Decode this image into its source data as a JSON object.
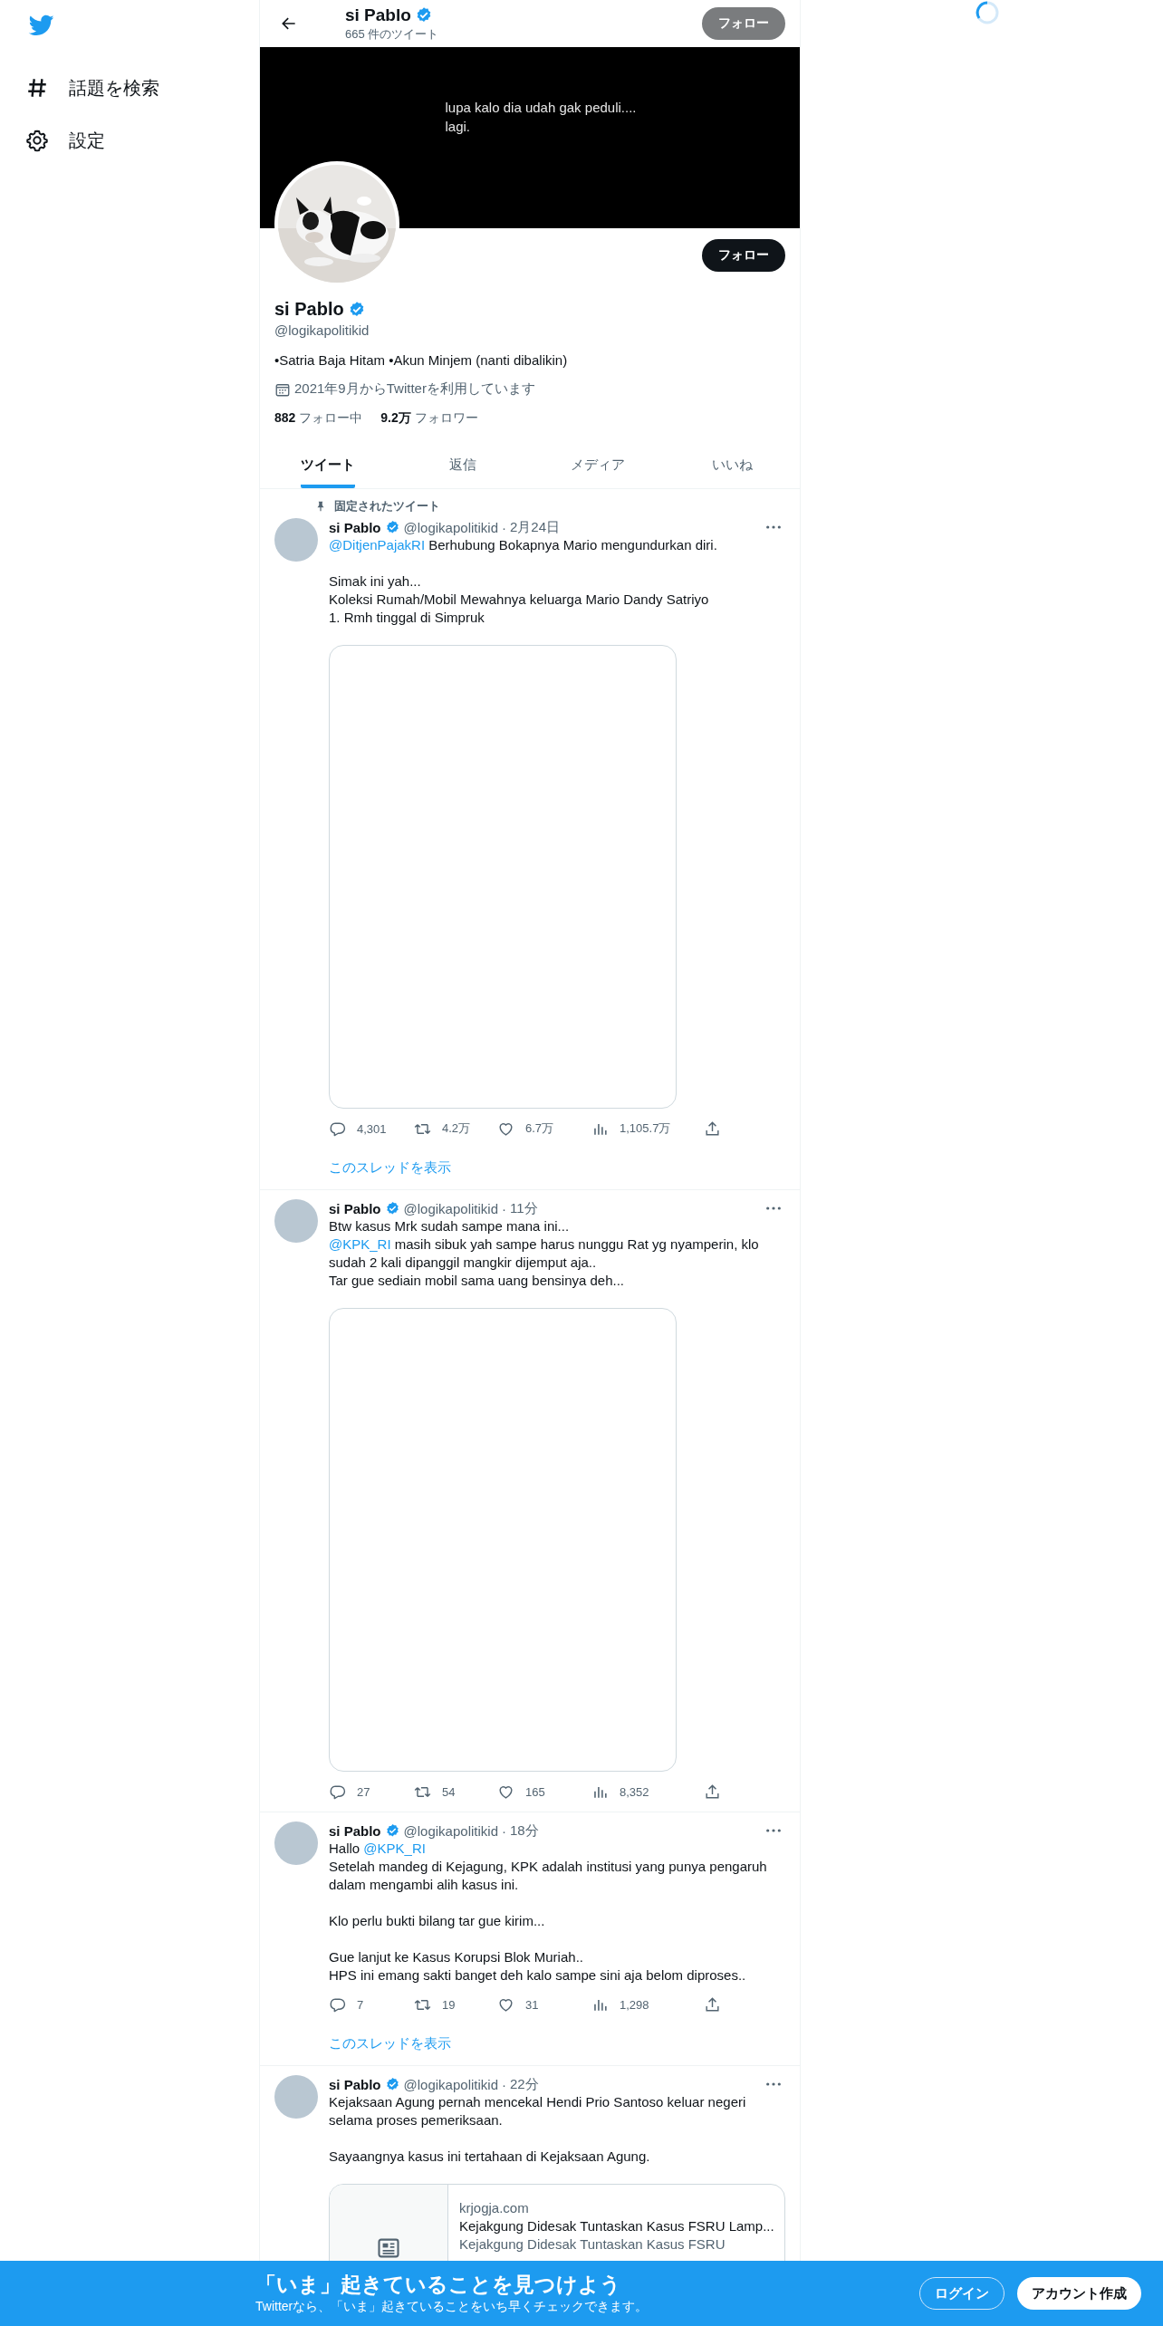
{
  "sidebar": {
    "items": [
      {
        "label": "話題を検索",
        "kind": "hashtag"
      },
      {
        "label": "設定",
        "kind": "gear"
      }
    ]
  },
  "header": {
    "title": "si Pablo",
    "subtitle": "665 件のツイート",
    "follow": "フォロー"
  },
  "banner": {
    "text": "lupa kalo dia udah gak peduli....\nlagi."
  },
  "profile": {
    "follow": "フォロー",
    "name": "si Pablo",
    "handle": "@logikapolitikid",
    "bio": "•Satria Baja Hitam •Akun Minjem (nanti dibalikin)",
    "joined": "2021年9月からTwitterを利用しています",
    "following_count": "882",
    "following_label": "フォロー中",
    "followers_count": "9.2万",
    "followers_label": "フォロワー"
  },
  "tabs": [
    {
      "label": "ツイート",
      "selected": true
    },
    {
      "label": "返信",
      "selected": false
    },
    {
      "label": "メディア",
      "selected": false
    },
    {
      "label": "いいね",
      "selected": false
    }
  ],
  "tweets": [
    {
      "pinned_label": "固定されたツイート",
      "name": "si Pablo",
      "handle": "@logikapolitikid",
      "separator": "·",
      "time": "2月24日",
      "paragraphs": [
        [
          {
            "kind": "mention",
            "text": "@DitjenPajakRI"
          },
          {
            "kind": "text",
            "text": " Berhubung Bokapnya Mario mengundurkan diri."
          }
        ],
        [
          {
            "kind": "text",
            "text": "Simak ini yah...\nKoleksi Rumah/Mobil Mewahnya keluarga Mario Dandy Satriyo\n1. Rmh tinggal di Simpruk"
          }
        ]
      ],
      "media": {
        "kind": "empty"
      },
      "stats": {
        "replies": "4,301",
        "retweets": "4.2万",
        "likes": "6.7万",
        "views": "1,105.7万"
      },
      "show_thread": "このスレッドを表示"
    },
    {
      "name": "si Pablo",
      "handle": "@logikapolitikid",
      "separator": "·",
      "time": "11分",
      "paragraphs": [
        [
          {
            "kind": "text",
            "text": "Btw kasus Mrk sudah sampe mana ini...\n"
          },
          {
            "kind": "mention",
            "text": "@KPK_RI"
          },
          {
            "kind": "text",
            "text": " masih sibuk yah sampe harus nunggu Rat yg nyamperin, klo sudah 2 kali dipanggil mangkir dijemput aja..\nTar gue sediain mobil sama uang bensinya deh..."
          }
        ]
      ],
      "media": {
        "kind": "empty"
      },
      "stats": {
        "replies": "27",
        "retweets": "54",
        "likes": "165",
        "views": "8,352"
      }
    },
    {
      "name": "si Pablo",
      "handle": "@logikapolitikid",
      "separator": "·",
      "time": "18分",
      "paragraphs": [
        [
          {
            "kind": "text",
            "text": "Hallo "
          },
          {
            "kind": "mention",
            "text": "@KPK_RI"
          },
          {
            "kind": "text",
            "text": "\nSetelah mandeg di Kejagung, KPK adalah institusi yang punya pengaruh dalam mengambi alih kasus ini."
          }
        ],
        [
          {
            "kind": "text",
            "text": "Klo perlu bukti bilang tar gue kirim..."
          }
        ],
        [
          {
            "kind": "text",
            "text": "Gue lanjut ke Kasus Korupsi Blok Muriah..\nHPS ini emang sakti banget deh kalo sampe sini aja belom diproses.."
          }
        ]
      ],
      "stats": {
        "replies": "7",
        "retweets": "19",
        "likes": "31",
        "views": "1,298"
      },
      "show_thread": "このスレッドを表示"
    },
    {
      "name": "si Pablo",
      "handle": "@logikapolitikid",
      "separator": "·",
      "time": "22分",
      "paragraphs": [
        [
          {
            "kind": "text",
            "text": "Kejaksaan Agung pernah mencekal Hendi Prio Santoso keluar negeri selama proses pemeriksaan."
          }
        ],
        [
          {
            "kind": "text",
            "text": "Sayaangnya kasus ini tertahaan di Kejaksaan Agung."
          }
        ]
      ],
      "link_card": {
        "domain": "krjogja.com",
        "title": "Kejakgung Didesak Tuntaskan Kasus FSRU Lamp...",
        "description": "Kejakgung Didesak Tuntaskan Kasus FSRU"
      }
    }
  ],
  "bottom_bar": {
    "title": "「いま」起きていることを見つけよう",
    "subtitle": "Twitterなら、「いま」起きていることをいち早くチェックできます。",
    "login": "ログイン",
    "signup": "アカウント作成"
  }
}
